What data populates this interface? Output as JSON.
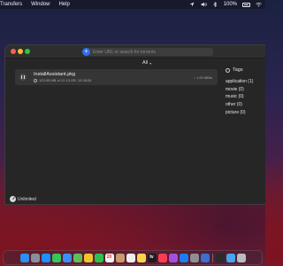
{
  "menubar": {
    "items": [
      "Transfers",
      "Window",
      "Help"
    ],
    "battery_text": "100%"
  },
  "window": {
    "url_placeholder": "Enter URL or search for torrents",
    "filter_label": "All",
    "download": {
      "name": "InstallAssistant.pkg",
      "status": "123.95 MB of 12.13 GB",
      "eta": "12:08:05",
      "speed": "↓ 1.00 MB/s"
    },
    "tags": {
      "title": "Tags",
      "items": [
        "application (1)",
        "movie (0)",
        "music (0)",
        "other (0)",
        "picture (0)"
      ]
    },
    "status_label": "Unlimited"
  },
  "dock": {
    "icons": [
      {
        "name": "finder-icon",
        "color": "#2f8ff0"
      },
      {
        "name": "launchpad-icon",
        "color": "#8a8f9a"
      },
      {
        "name": "safari-icon",
        "color": "#1e90ff"
      },
      {
        "name": "messages-icon",
        "color": "#34c759"
      },
      {
        "name": "mail-icon",
        "color": "#3a8ef6"
      },
      {
        "name": "maps-icon",
        "color": "#5cbf5a"
      },
      {
        "name": "photos-icon",
        "color": "#f4c430"
      },
      {
        "name": "facetime-icon",
        "color": "#2fbf4f"
      },
      {
        "name": "calendar-icon",
        "color": "#f2f2f2"
      },
      {
        "name": "contacts-icon",
        "color": "#c89b6c"
      },
      {
        "name": "reminders-icon",
        "color": "#eeeeee"
      },
      {
        "name": "notes-icon",
        "color": "#f7d54a"
      },
      {
        "name": "tv-icon",
        "color": "#1c1c1c"
      },
      {
        "name": "music-icon",
        "color": "#fa3c55"
      },
      {
        "name": "podcasts-icon",
        "color": "#a64ee0"
      },
      {
        "name": "appstore-icon",
        "color": "#1e7cf0"
      },
      {
        "name": "settings-icon",
        "color": "#8e8e93"
      },
      {
        "name": "torrent-app-icon",
        "color": "#3b6fd0"
      },
      {
        "name": "terminal-icon",
        "color": "#2b2b2b"
      },
      {
        "name": "downloads-folder-icon",
        "color": "#4aa3f0"
      },
      {
        "name": "trash-icon",
        "color": "#b8bcc2"
      }
    ],
    "calendar_day": "20",
    "tv_label": "tv"
  }
}
